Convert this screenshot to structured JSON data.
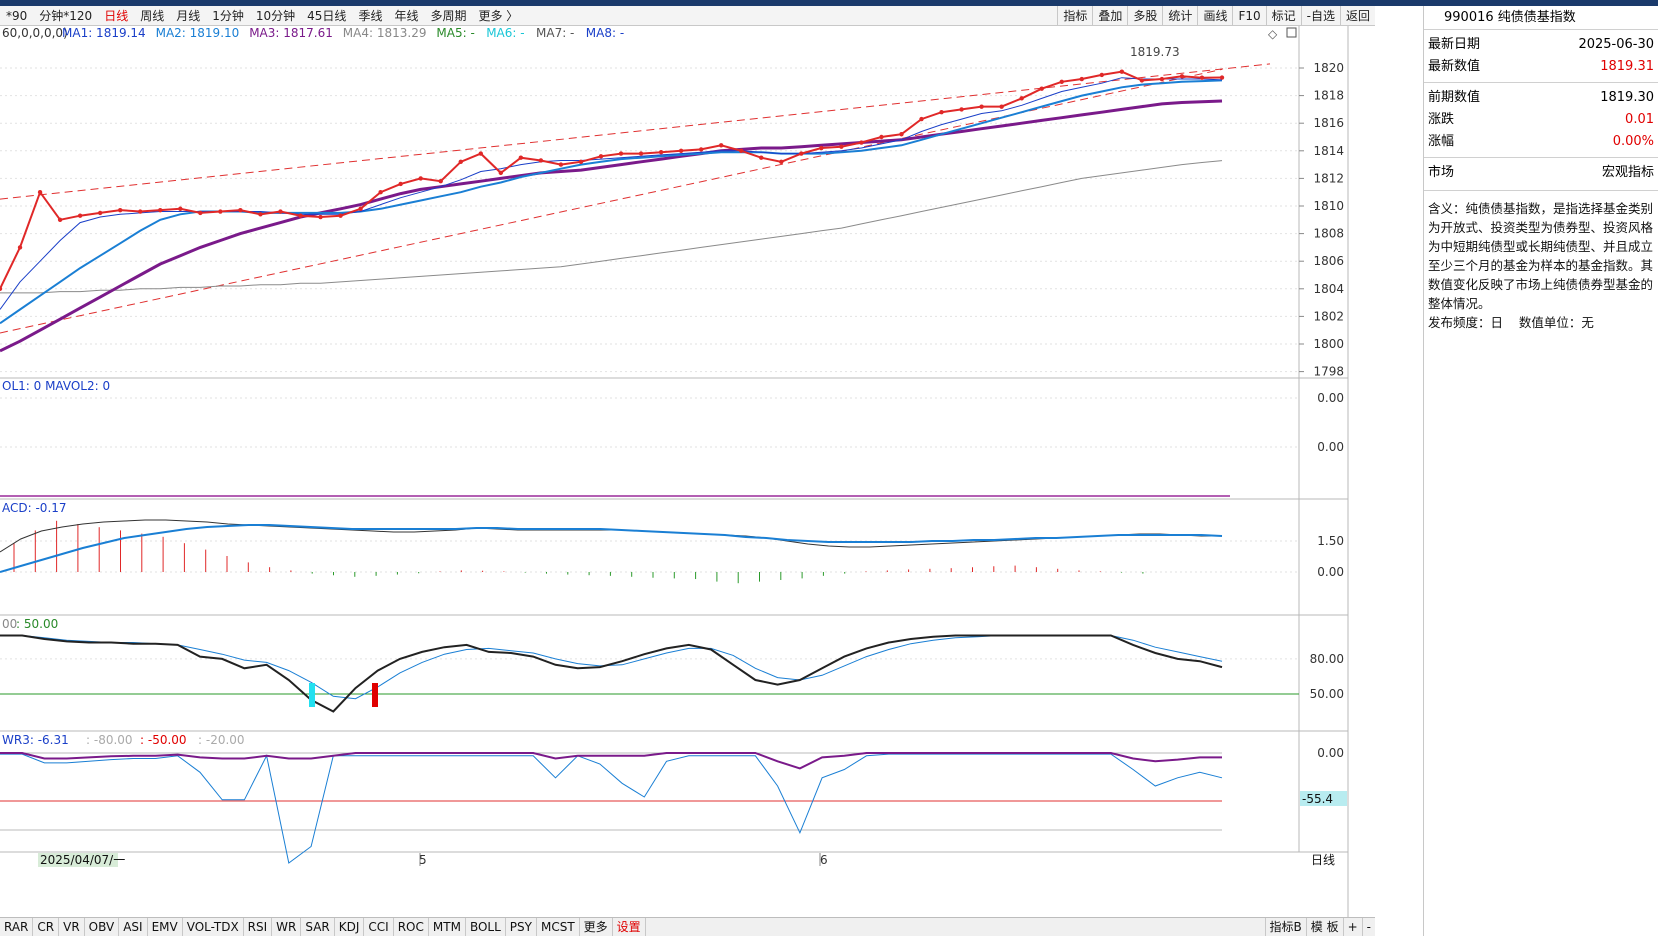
{
  "toolbar": {
    "periods": [
      {
        "label": "*90",
        "active": false
      },
      {
        "label": "分钟*120",
        "active": false
      },
      {
        "label": "日线",
        "active": true
      },
      {
        "label": "周线",
        "active": false
      },
      {
        "label": "月线",
        "active": false
      },
      {
        "label": "1分钟",
        "active": false
      },
      {
        "label": "10分钟",
        "active": false
      },
      {
        "label": "45日线",
        "active": false
      },
      {
        "label": "季线",
        "active": false
      },
      {
        "label": "年线",
        "active": false
      },
      {
        "label": "多周期",
        "active": false
      },
      {
        "label": "更多 〉",
        "active": false
      }
    ],
    "tools": [
      "指标",
      "叠加",
      "多股",
      "统计",
      "画线",
      "F10",
      "标记",
      "-自选",
      "返回"
    ]
  },
  "ma_legend": {
    "params": "60,0,0,0,0)",
    "items": [
      {
        "text": "MA1: 1819.14",
        "color": "#1a3fc8"
      },
      {
        "text": "MA2: 1819.10",
        "color": "#1a7fd4"
      },
      {
        "text": "MA3: 1817.61",
        "color": "#7a1a8a"
      },
      {
        "text": "MA4: 1813.29",
        "color": "#888888"
      },
      {
        "text": "MA5: -",
        "color": "#2a8a2a"
      },
      {
        "text": "MA6: -",
        "color": "#19c6d6"
      },
      {
        "text": "MA7: -",
        "color": "#555555"
      },
      {
        "text": "MA8: -",
        "color": "#1a3fc8"
      }
    ],
    "high_label": "1819.73"
  },
  "price_axis": [
    "1820",
    "1818",
    "1816",
    "1814",
    "1812",
    "1810",
    "1808",
    "1806",
    "1804",
    "1802",
    "1800",
    "1798"
  ],
  "vol_panel": {
    "legend": "OL1: 0  MAVOL2: 0",
    "ticks": [
      "0.00",
      "0.00"
    ]
  },
  "macd_panel": {
    "legend": "ACD: -0.17",
    "ticks": [
      "1.50",
      "0.00"
    ]
  },
  "kdj_panel": {
    "legend_prefix": "00",
    "legend_value": ": 50.00",
    "ticks": [
      "80.00",
      "50.00"
    ]
  },
  "wr_panel": {
    "legend_main": "WR3: -6.31",
    "legend_a": ": -80.00",
    "legend_b": ": -50.00",
    "legend_c": ": -20.00",
    "ticks": [
      "0.00"
    ],
    "marker": "-55.4"
  },
  "date_axis": {
    "start": "2025/04/07/一",
    "m5": "5",
    "m6": "6",
    "period": "日线"
  },
  "bottom_tabs": [
    "RAR",
    "CR",
    "VR",
    "OBV",
    "ASI",
    "EMV",
    "VOL-TDX",
    "RSI",
    "WR",
    "SAR",
    "KDJ",
    "CCI",
    "ROC",
    "MTM",
    "BOLL",
    "PSY",
    "MCST",
    "更多",
    "设置"
  ],
  "bottom_right": [
    "指标B",
    "模 板",
    "+",
    "-"
  ],
  "side": {
    "title": "990016 纯债债基指数",
    "rows1": [
      {
        "label": "最新日期",
        "value": "2025-06-30",
        "red": false
      },
      {
        "label": "最新数值",
        "value": "1819.31",
        "red": true
      }
    ],
    "rows2": [
      {
        "label": "前期数值",
        "value": "1819.30",
        "red": false
      },
      {
        "label": "涨跌",
        "value": "0.01",
        "red": true
      },
      {
        "label": "涨幅",
        "value": "0.00%",
        "red": true
      }
    ],
    "rows3": [
      {
        "label": "市场",
        "value": "宏观指标",
        "red": false
      }
    ],
    "description": "含义：纯债债基指数，是指选择基金类别为开放式、投资类型为债券型、投资风格为中短期纯债型或长期纯债型、并且成立至少三个月的基金为样本的基金指数。其数值变化反映了市场上纯债债券型基金的整体情况。",
    "footer": "发布频度：日    数值单位：无"
  },
  "chart_data": {
    "type": "line",
    "y_range": [
      1797,
      1821
    ],
    "close": [
      1804,
      1807,
      1811,
      1809,
      1809.3,
      1809.5,
      1809.7,
      1809.6,
      1809.7,
      1809.8,
      1809.5,
      1809.6,
      1809.7,
      1809.4,
      1809.6,
      1809.3,
      1809.2,
      1809.3,
      1809.8,
      1811,
      1811.6,
      1812.0,
      1811.8,
      1813.2,
      1813.8,
      1812.4,
      1813.5,
      1813.3,
      1813.0,
      1813.2,
      1813.6,
      1813.8,
      1813.8,
      1813.9,
      1814.0,
      1814.1,
      1814.4,
      1814.0,
      1813.5,
      1813.2,
      1813.8,
      1814.2,
      1814.3,
      1814.6,
      1815.0,
      1815.2,
      1816.3,
      1816.8,
      1817.0,
      1817.2,
      1817.2,
      1817.8,
      1818.5,
      1819.0,
      1819.2,
      1819.5,
      1819.73,
      1819.1,
      1819.2,
      1819.4,
      1819.3,
      1819.31
    ],
    "ma1": [
      1802.5,
      1804.5,
      1806.0,
      1807.5,
      1808.8,
      1809.2,
      1809.4,
      1809.5,
      1809.6,
      1809.6,
      1809.6,
      1809.6,
      1809.6,
      1809.6,
      1809.5,
      1809.4,
      1809.4,
      1809.4,
      1809.6,
      1810.1,
      1810.6,
      1811.0,
      1811.4,
      1811.9,
      1812.5,
      1812.7,
      1813.0,
      1813.2,
      1813.3,
      1813.3,
      1813.4,
      1813.5,
      1813.6,
      1813.7,
      1813.8,
      1813.9,
      1814.0,
      1814.0,
      1813.9,
      1813.8,
      1813.8,
      1813.9,
      1814.0,
      1814.2,
      1814.5,
      1814.8,
      1815.4,
      1815.9,
      1816.3,
      1816.7,
      1816.9,
      1817.3,
      1817.8,
      1818.3,
      1818.6,
      1818.9,
      1819.3,
      1819.2,
      1819.2,
      1819.2,
      1819.2,
      1819.14
    ],
    "ma2": [
      1801.5,
      1802.5,
      1803.5,
      1804.5,
      1805.5,
      1806.4,
      1807.3,
      1808.2,
      1809.0,
      1809.4,
      1809.6,
      1809.6,
      1809.6,
      1809.5,
      1809.5,
      1809.5,
      1809.5,
      1809.5,
      1809.6,
      1809.8,
      1810.1,
      1810.4,
      1810.7,
      1811.0,
      1811.4,
      1811.7,
      1812.1,
      1812.4,
      1812.7,
      1813.0,
      1813.2,
      1813.4,
      1813.5,
      1813.6,
      1813.7,
      1813.8,
      1813.9,
      1813.9,
      1813.9,
      1813.8,
      1813.8,
      1813.8,
      1813.9,
      1814.0,
      1814.2,
      1814.4,
      1814.8,
      1815.2,
      1815.6,
      1816.0,
      1816.4,
      1816.8,
      1817.2,
      1817.6,
      1818.0,
      1818.3,
      1818.6,
      1818.8,
      1818.9,
      1819.0,
      1819.05,
      1819.1
    ],
    "ma3": [
      1799.5,
      1800.2,
      1801.0,
      1801.8,
      1802.6,
      1803.4,
      1804.2,
      1805.0,
      1805.8,
      1806.4,
      1807.0,
      1807.5,
      1808.0,
      1808.4,
      1808.8,
      1809.2,
      1809.5,
      1809.8,
      1810.1,
      1810.5,
      1810.9,
      1811.2,
      1811.4,
      1811.6,
      1811.8,
      1812.0,
      1812.2,
      1812.4,
      1812.5,
      1812.6,
      1812.8,
      1813.0,
      1813.2,
      1813.4,
      1813.6,
      1813.8,
      1814.0,
      1814.1,
      1814.2,
      1814.2,
      1814.3,
      1814.4,
      1814.5,
      1814.6,
      1814.7,
      1814.8,
      1815.0,
      1815.2,
      1815.4,
      1815.6,
      1815.8,
      1816.0,
      1816.2,
      1816.4,
      1816.6,
      1816.8,
      1817.0,
      1817.2,
      1817.4,
      1817.5,
      1817.55,
      1817.61
    ],
    "ma4": [
      1803.7,
      1803.7,
      1803.7,
      1803.8,
      1803.8,
      1803.9,
      1803.9,
      1804.0,
      1804.0,
      1804.1,
      1804.1,
      1804.2,
      1804.2,
      1804.3,
      1804.3,
      1804.4,
      1804.4,
      1804.5,
      1804.6,
      1804.7,
      1804.8,
      1804.9,
      1805.0,
      1805.1,
      1805.2,
      1805.3,
      1805.4,
      1805.5,
      1805.6,
      1805.8,
      1806.0,
      1806.2,
      1806.4,
      1806.6,
      1806.8,
      1807.0,
      1807.2,
      1807.4,
      1807.6,
      1807.8,
      1808.0,
      1808.2,
      1808.4,
      1808.7,
      1809.0,
      1809.3,
      1809.6,
      1809.9,
      1810.2,
      1810.5,
      1810.8,
      1811.1,
      1811.4,
      1811.7,
      1812.0,
      1812.2,
      1812.4,
      1812.6,
      1812.8,
      1813.0,
      1813.15,
      1813.29
    ],
    "macd_bars": [
      0.9,
      1.3,
      1.6,
      1.5,
      1.4,
      1.3,
      1.2,
      1.1,
      0.9,
      0.7,
      0.5,
      0.3,
      0.15,
      0.05,
      -0.05,
      -0.1,
      -0.15,
      -0.12,
      -0.08,
      -0.04,
      0.02,
      0.05,
      0.04,
      0.02,
      -0.02,
      -0.05,
      -0.08,
      -0.1,
      -0.12,
      -0.15,
      -0.18,
      -0.2,
      -0.22,
      -0.3,
      -0.35,
      -0.3,
      -0.25,
      -0.2,
      -0.12,
      -0.05,
      0.02,
      0.05,
      0.08,
      0.1,
      0.12,
      0.15,
      0.18,
      0.2,
      0.15,
      0.1,
      0.05,
      0.02,
      -0.02,
      -0.05
    ],
    "kdj_k": [
      100,
      100,
      97,
      95,
      94,
      94,
      93,
      93,
      92,
      82,
      80,
      72,
      75,
      62,
      45,
      35,
      55,
      70,
      80,
      86,
      90,
      92,
      86,
      85,
      82,
      75,
      72,
      73,
      78,
      84,
      89,
      92,
      88,
      75,
      62,
      58,
      62,
      72,
      82,
      89,
      94,
      97,
      99,
      100,
      100,
      100,
      100,
      100,
      100,
      100,
      100,
      92,
      85,
      80,
      78,
      73
    ],
    "kdj_d": [
      100,
      100,
      98,
      96,
      95,
      94,
      94,
      93,
      92,
      88,
      84,
      79,
      77,
      70,
      60,
      48,
      46,
      56,
      68,
      77,
      84,
      88,
      89,
      87,
      85,
      80,
      76,
      74,
      75,
      80,
      85,
      89,
      89,
      83,
      72,
      64,
      62,
      66,
      74,
      82,
      88,
      93,
      96,
      98,
      99,
      100,
      100,
      100,
      100,
      100,
      100,
      96,
      90,
      86,
      82,
      78
    ],
    "wr_1": [
      -2,
      -2,
      -18,
      -18,
      -15,
      -12,
      -10,
      -10,
      -5,
      -35,
      -85,
      -85,
      -5,
      -200,
      -170,
      -5,
      -5,
      -5,
      -5,
      -5,
      -5,
      -5,
      -5,
      -5,
      -5,
      -45,
      -5,
      -20,
      -55,
      -80,
      -15,
      -5,
      -5,
      -5,
      -5,
      -60,
      -145,
      -45,
      -30,
      -5,
      -2,
      -2,
      -2,
      -2,
      -2,
      -2,
      -2,
      -2,
      -2,
      -2,
      -2,
      -30,
      -60,
      -45,
      -35,
      -45
    ],
    "wr_2": [
      0,
      0,
      -10,
      -10,
      -8,
      -6,
      -5,
      -5,
      -3,
      -8,
      -10,
      -10,
      -5,
      -10,
      -10,
      -5,
      0,
      0,
      0,
      0,
      0,
      0,
      0,
      0,
      0,
      -10,
      -5,
      -5,
      -5,
      -5,
      0,
      0,
      0,
      0,
      0,
      -15,
      -28,
      -8,
      -5,
      0,
      0,
      0,
      0,
      0,
      0,
      0,
      0,
      0,
      0,
      0,
      0,
      -10,
      -15,
      -12,
      -8,
      -8
    ]
  }
}
